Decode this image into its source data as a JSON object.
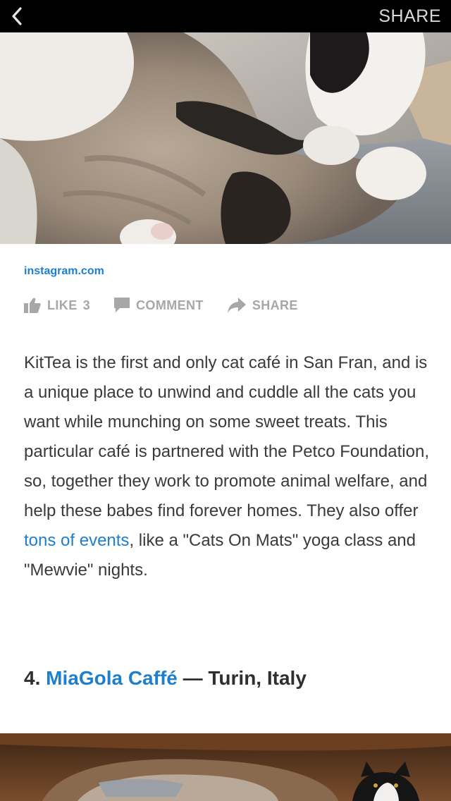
{
  "topbar": {
    "back_icon": "chevron-left-icon",
    "share_label": "SHARE"
  },
  "hero": {
    "image": "cat-photo"
  },
  "source": {
    "label": "instagram.com"
  },
  "actions": {
    "like_label": "LIKE",
    "like_count": "3",
    "like_icon": "thumbs-up-icon",
    "comment_label": "COMMENT",
    "comment_icon": "speech-bubble-icon",
    "share_label": "SHARE",
    "share_icon": "share-arrow-icon"
  },
  "article": {
    "paragraph_before_link": "KitTea is the first and only cat café in San Fran, and is a unique place to unwind and cuddle all the cats you want while munching on some sweet treats. This particular café is partnered with the Petco Foundation, so, together they work to promote animal welfare, and help these babes find forever homes. They also offer ",
    "paragraph_link": "tons of events",
    "paragraph_after_link": ", like a \"Cats On Mats\" yoga class and \"Mewvie\" nights."
  },
  "section": {
    "number": "4.",
    "name_link": "MiaGola Caffé",
    "location": " — Turin, Italy"
  },
  "bottom_image": {
    "image": "cafe-photo"
  },
  "colors": {
    "link": "#1e7fcf",
    "topbar": "#000000",
    "action_gray": "#a7a7a7",
    "body_text": "#3a3a3a"
  }
}
